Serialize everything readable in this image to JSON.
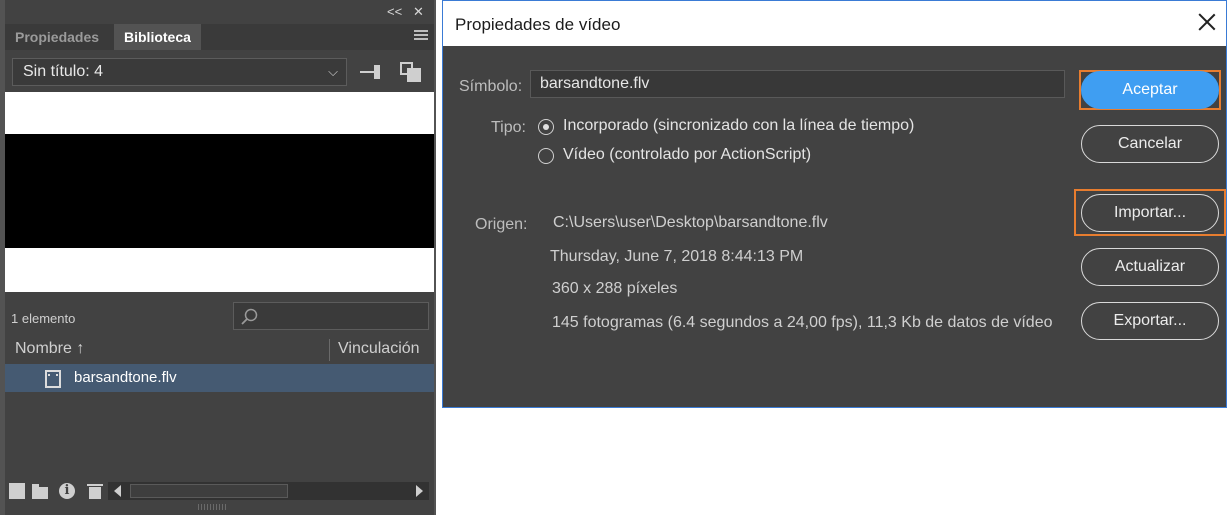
{
  "library_panel": {
    "topbar": {
      "collapse_glyph": "<<",
      "close_glyph": "✕"
    },
    "tabs": [
      {
        "label": "Propiedades",
        "active": false
      },
      {
        "label": "Biblioteca",
        "active": true
      }
    ],
    "document_select": {
      "value": "Sin título: 4"
    },
    "item_count": "1 elemento",
    "search": {
      "placeholder": ""
    },
    "columns": {
      "name": "Nombre",
      "sort_glyph": "↑",
      "linkage": "Vinculación"
    },
    "items": [
      {
        "name": "barsandtone.flv",
        "type": "video",
        "selected": true
      }
    ],
    "icons": [
      "new-symbol-icon",
      "new-folder-icon",
      "properties-icon",
      "delete-icon"
    ]
  },
  "dialog": {
    "title": "Propiedades de vídeo",
    "symbol_label": "Símbolo:",
    "symbol_value": "barsandtone.flv",
    "type_label": "Tipo:",
    "type_options": [
      {
        "label": "Incorporado (sincronizado con la línea de tiempo)",
        "selected": true
      },
      {
        "label": "Vídeo (controlado por ActionScript)",
        "selected": false
      }
    ],
    "origin_label": "Origen:",
    "origin_path": "C:\\Users\\user\\Desktop\\barsandtone.flv",
    "origin_date": "Thursday, June 7, 2018  8:44:13 PM",
    "origin_size": "360 x 288 píxeles",
    "origin_frames": "145 fotogramas (6.4 segundos a 24,00 fps), 11,3 Kb de datos de vídeo",
    "buttons": {
      "ok": "Aceptar",
      "cancel": "Cancelar",
      "import": "Importar...",
      "update": "Actualizar",
      "export": "Exportar..."
    },
    "colors": {
      "primary": "#3f9ef2",
      "highlight": "#e87d2f",
      "panel": "#424242"
    }
  }
}
